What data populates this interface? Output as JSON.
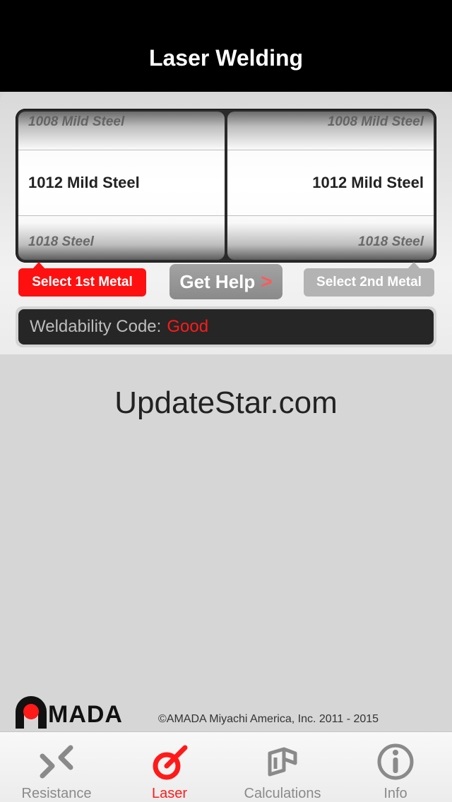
{
  "nav": {
    "title": "Laser Welding"
  },
  "picker": {
    "left": {
      "above": "1008 Mild Steel",
      "selected": "1012 Mild Steel",
      "below": "1018 Steel"
    },
    "right": {
      "above": "1008 Mild Steel",
      "selected": "1012 Mild Steel",
      "below": "1018 Steel"
    }
  },
  "buttons": {
    "select_first": "Select 1st Metal",
    "get_help": "Get Help",
    "get_help_chevron": ">",
    "select_second": "Select 2nd Metal"
  },
  "weldability": {
    "label": "Weldability Code:",
    "value": "Good"
  },
  "watermark": "UpdateStar.com",
  "footer": {
    "logo": "MADA",
    "copyright": "©AMADA Miyachi America, Inc. 2011 - 2015"
  },
  "tabs": [
    {
      "label": "Resistance",
      "icon": "resistance-icon"
    },
    {
      "label": "Laser",
      "icon": "laser-icon"
    },
    {
      "label": "Calculations",
      "icon": "calculations-icon"
    },
    {
      "label": "Info",
      "icon": "info-icon"
    }
  ],
  "colors": {
    "accent": "#ff1a1a",
    "inactive": "#8a8a8a"
  }
}
